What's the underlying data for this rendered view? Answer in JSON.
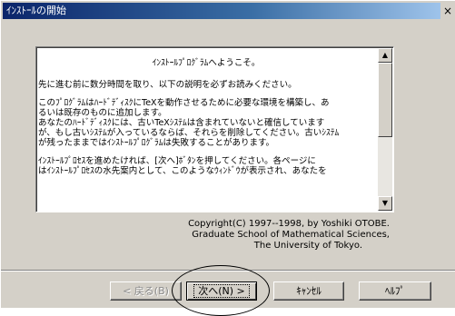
{
  "window": {
    "title": "ｲﾝｽﾄｰﾙの開始",
    "close_label": "×"
  },
  "textbox": {
    "welcome": "ｲﾝｽﾄｰﾙﾌﾟﾛｸﾞﾗﾑへようこそ。",
    "para1": "先に進む前に数分時間を取り、以下の説明を必ずお読みください。",
    "para2": [
      "このﾌﾟﾛｸﾞﾗﾑはﾊｰﾄﾞﾃﾞｨｽｸにTeXを動作させるために必要な環境を構築し、あ",
      "るいは既存のものに追加します。",
      "あなたのﾊｰﾄﾞﾃﾞｨｽｸには、古いTeXｼｽﾃﾑは含まれていないと確信しています",
      "が、もし古いｼｽﾃﾑが入っているならば、それらを削除してください。古いｼｽﾃﾑ",
      "が残ったままではｲﾝｽﾄｰﾙﾌﾟﾛｸﾞﾗﾑは失敗することがあります。"
    ],
    "para3": [
      "ｲﾝｽﾄｰﾙﾌﾟﾛｾｽを進めたければ、[次へ]ﾎﾞﾀﾝを押してください。各ページに",
      "はｲﾝｽﾄｰﾙﾌﾟﾛｾｽの水先案内として、このようなｳｨﾝﾄﾞｳが表示され、あなたを"
    ],
    "scroll_up": "▲",
    "scroll_down": "▼"
  },
  "copyright": {
    "line1": "Copyright(C) 1997--1998, by Yoshiki OTOBE.",
    "line2": "Graduate School of Mathematical Sciences,",
    "line3": "The University of Tokyo."
  },
  "buttons": {
    "back": "< 戻る(B)",
    "next": "次へ(N) >",
    "cancel": "ｷｬﾝｾﾙ",
    "help": "ﾍﾙﾌﾟ"
  }
}
